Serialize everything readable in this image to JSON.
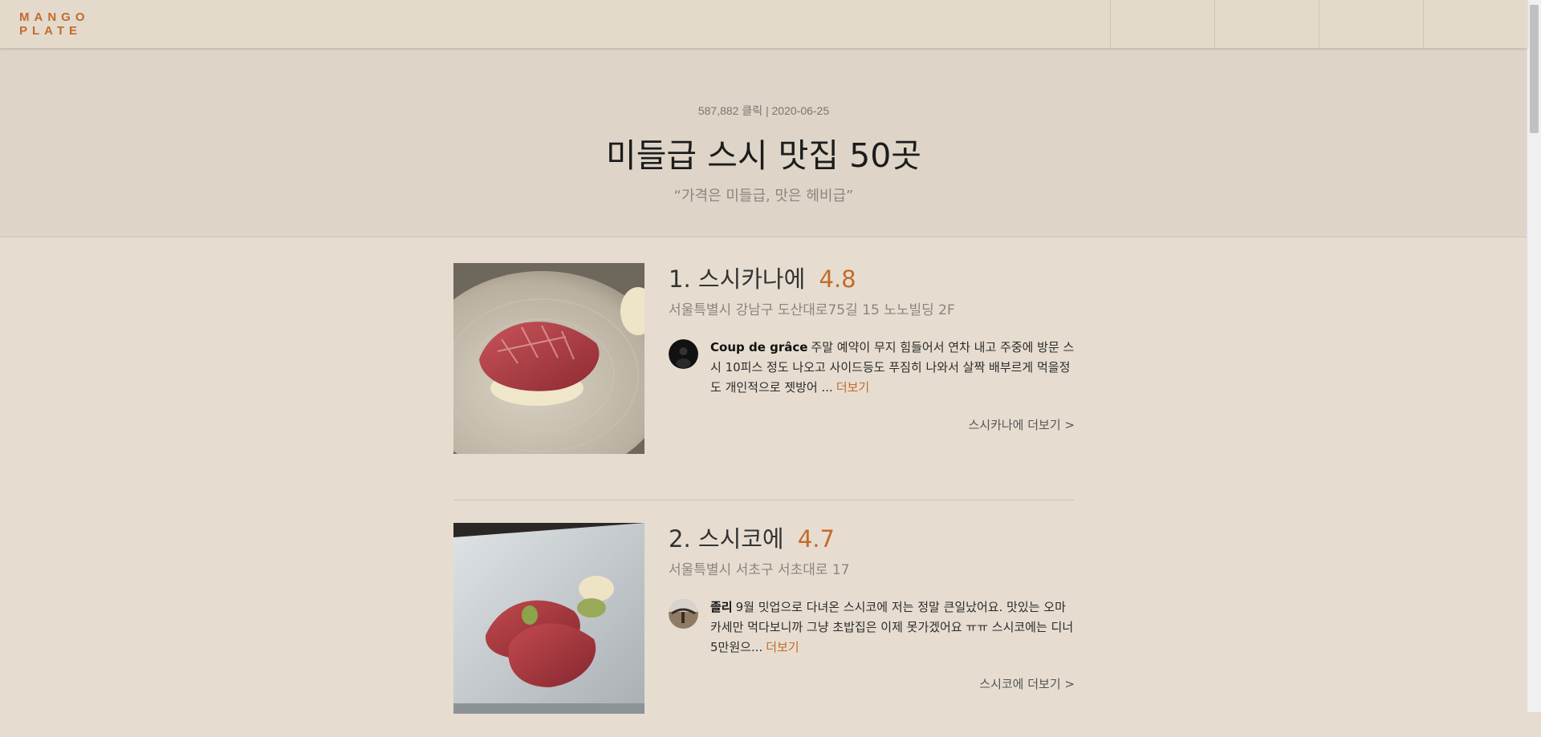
{
  "header": {
    "logo_line1": "MANGO",
    "logo_line2": "PLATE",
    "nav_cells": [
      "",
      "",
      "",
      ""
    ]
  },
  "hero": {
    "meta": "587,882 클릭 | 2020-06-25",
    "title": "미들급 스시 맛집 50곳",
    "subtitle": "“가격은 미들급, 맛은 헤비급”"
  },
  "restaurants": [
    {
      "rank": "1.",
      "name": "스시카나에",
      "score": "4.8",
      "address": "서울특별시 강남구 도산대로75길 15 노노빌딩 2F",
      "photo_icon": "tuna-sushi-photo",
      "avatar_icon": "dark-avatar",
      "reviewer": "Coup de grâce",
      "review": "주말 예약이 무지 힘들어서 연차 내고 주중에 방문 스시 10피스 정도 나오고 사이드등도 푸짐히 나와서 살짝 배부르게 먹을정도 개인적으로 젯방어 ...",
      "more_label": "더보기",
      "detail_label": "스시카나에 더보기 >"
    },
    {
      "rank": "2.",
      "name": "스시코에",
      "score": "4.7",
      "address": "서울특별시 서초구 서초대로 17",
      "photo_icon": "tuna-sushi-pair-photo",
      "avatar_icon": "photo-avatar",
      "reviewer": "졸리",
      "review": "9월 밋업으로 다녀온 스시코에 저는 정말 큰일났어요. 맛있는 오마카세만 먹다보니까 그냥 초밥집은 이제 못가겠어요 ㅠㅠ 스시코에는 디너 5만원으...",
      "more_label": "더보기",
      "detail_label": "스시코에 더보기 >"
    }
  ],
  "colors": {
    "accent": "#c46a2a",
    "background": "#e6ddd0",
    "hero_bg": "#ded5c8"
  }
}
